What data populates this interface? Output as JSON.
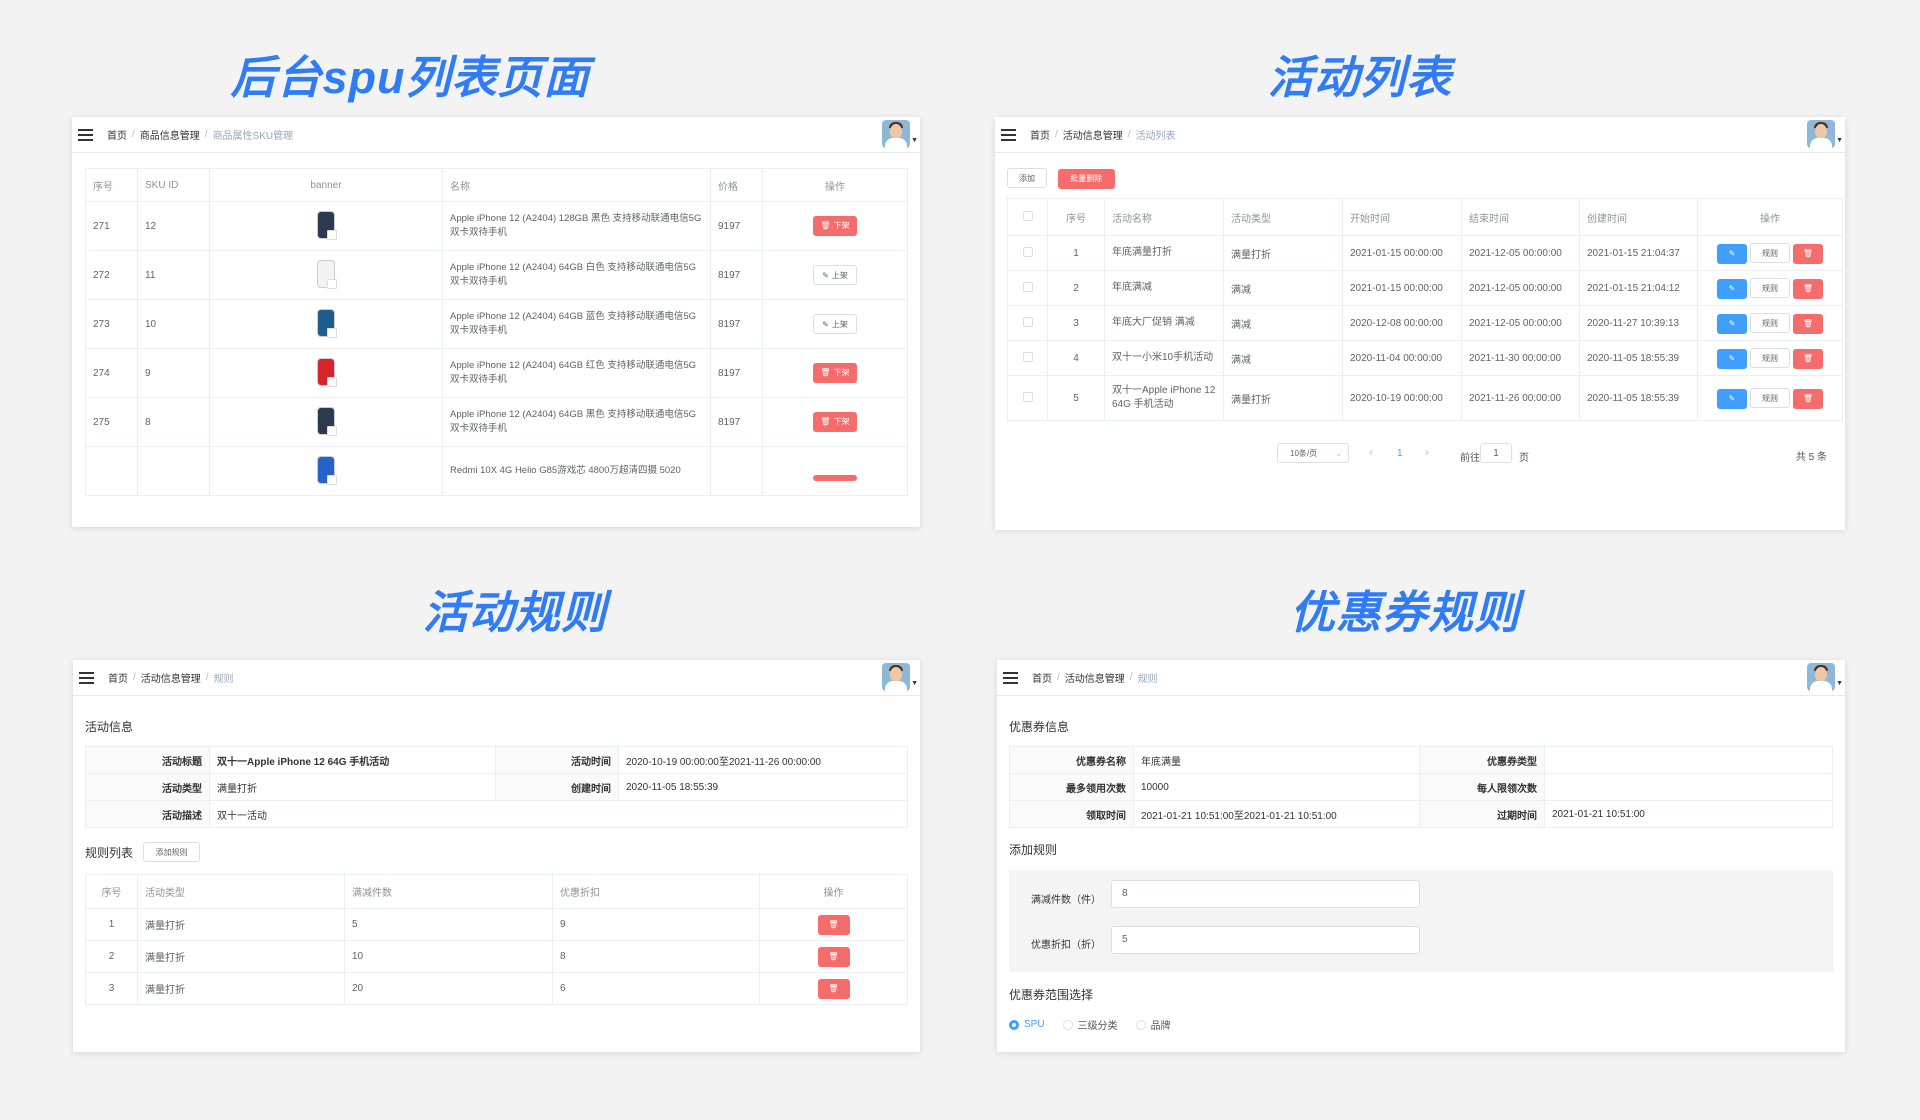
{
  "titles": {
    "spu": "后台spu列表页面",
    "activity_list": "活动列表",
    "activity_rule": "活动规则",
    "coupon_rule": "优惠券规则"
  },
  "colors": {
    "title": "#2f7cf6",
    "danger": "#f56c6c",
    "primary": "#409eff"
  },
  "panel1": {
    "breadcrumb": [
      "首页",
      "商品信息管理",
      "商品属性SKU管理"
    ],
    "headers": [
      "序号",
      "SKU ID",
      "banner",
      "名称",
      "价格",
      "操作"
    ],
    "rows": [
      {
        "no": "271",
        "sku": "12",
        "phone_color": "#2b3a4f",
        "name": "Apple iPhone 12 (A2404) 128GB 黑色 支持移动联通电信5G 双卡双待手机",
        "price": "9197",
        "action": "下架",
        "action_icon": "trash-icon",
        "action_type": "danger"
      },
      {
        "no": "272",
        "sku": "11",
        "phone_color": "#f3f3f3",
        "name": "Apple iPhone 12 (A2404) 64GB 白色 支持移动联通电信5G 双卡双待手机",
        "price": "8197",
        "action": "上架",
        "action_icon": "edit-icon",
        "action_type": "plain"
      },
      {
        "no": "273",
        "sku": "10",
        "phone_color": "#1f5d8c",
        "name": "Apple iPhone 12 (A2404) 64GB 蓝色 支持移动联通电信5G 双卡双待手机",
        "price": "8197",
        "action": "上架",
        "action_icon": "edit-icon",
        "action_type": "plain"
      },
      {
        "no": "274",
        "sku": "9",
        "phone_color": "#d8232a",
        "name": "Apple iPhone 12 (A2404) 64GB 红色 支持移动联通电信5G 双卡双待手机",
        "price": "8197",
        "action": "下架",
        "action_icon": "trash-icon",
        "action_type": "danger"
      },
      {
        "no": "275",
        "sku": "8",
        "phone_color": "#2b3a4f",
        "name": "Apple iPhone 12 (A2404) 64GB 黑色 支持移动联通电信5G 双卡双待手机",
        "price": "8197",
        "action": "下架",
        "action_icon": "trash-icon",
        "action_type": "danger"
      },
      {
        "no": "",
        "sku": "",
        "phone_color": "#2563c9",
        "name": "Redmi 10X 4G Helio G85游戏芯 4800万超清四摄 5020",
        "price": "",
        "action": "",
        "action_icon": "",
        "action_type": "danger"
      }
    ]
  },
  "panel2": {
    "breadcrumb": [
      "首页",
      "活动信息管理",
      "活动列表"
    ],
    "add_label": "添加",
    "batch_delete_label": "批量删除",
    "headers": [
      "序号",
      "活动名称",
      "活动类型",
      "开始时间",
      "结束时间",
      "创建时间",
      "操作"
    ],
    "rows": [
      {
        "no": "1",
        "name": "年底满量打折",
        "type": "满量打折",
        "start": "2021-01-15 00:00:00",
        "end": "2021-12-05 00:00:00",
        "created": "2021-01-15 21:04:37"
      },
      {
        "no": "2",
        "name": "年底满减",
        "type": "满减",
        "start": "2021-01-15 00:00:00",
        "end": "2021-12-05 00:00:00",
        "created": "2021-01-15 21:04:12"
      },
      {
        "no": "3",
        "name": "年底大厂促销 满减",
        "type": "满减",
        "start": "2020-12-08 00:00:00",
        "end": "2021-12-05 00:00:00",
        "created": "2020-11-27 10:39:13"
      },
      {
        "no": "4",
        "name": "双十一小米10手机活动",
        "type": "满减",
        "start": "2020-11-04 00:00:00",
        "end": "2021-11-30 00:00:00",
        "created": "2020-11-05 18:55:39"
      },
      {
        "no": "5",
        "name": "双十一Apple iPhone 12 64G 手机活动",
        "type": "满量打折",
        "start": "2020-10-19 00:00:00",
        "end": "2021-11-26 00:00:00",
        "created": "2020-11-05 18:55:39"
      }
    ],
    "rule_label": "规则",
    "pagination": {
      "page_size": "10条/页",
      "current_page": "1",
      "goto_label": "前往",
      "goto_value": "1",
      "page_unit": "页",
      "total": "共 5 条"
    }
  },
  "panel3": {
    "breadcrumb": [
      "首页",
      "活动信息管理",
      "规则"
    ],
    "info_heading": "活动信息",
    "info": {
      "title_label": "活动标题",
      "title_value": "双十一Apple iPhone 12 64G 手机活动",
      "time_label": "活动时间",
      "time_value": "2020-10-19 00:00:00至2021-11-26 00:00:00",
      "type_label": "活动类型",
      "type_value": "满量打折",
      "created_label": "创建时间",
      "created_value": "2020-11-05 18:55:39",
      "desc_label": "活动描述",
      "desc_value": "双十一活动"
    },
    "rules_heading": "规则列表",
    "add_rule_label": "添加规则",
    "headers": [
      "序号",
      "活动类型",
      "满减件数",
      "优惠折扣",
      "操作"
    ],
    "rows": [
      {
        "no": "1",
        "type": "满量打折",
        "count": "5",
        "discount": "9"
      },
      {
        "no": "2",
        "type": "满量打折",
        "count": "10",
        "discount": "8"
      },
      {
        "no": "3",
        "type": "满量打折",
        "count": "20",
        "discount": "6"
      }
    ]
  },
  "panel4": {
    "breadcrumb": [
      "首页",
      "活动信息管理",
      "规则"
    ],
    "info_heading": "优惠券信息",
    "info": {
      "name_label": "优惠券名称",
      "name_value": "年底满量",
      "type_label": "优惠券类型",
      "type_value": "",
      "max_label": "最多领用次数",
      "max_value": "10000",
      "limit_label": "每人限领次数",
      "limit_value": "",
      "get_time_label": "领取时间",
      "get_time_value": "2021-01-21 10:51:00至2021-01-21 10:51:00",
      "expire_label": "过期时间",
      "expire_value": "2021-01-21 10:51:00"
    },
    "add_rule_heading": "添加规则",
    "form": {
      "count_label": "满减件数（件）",
      "count_value": "8",
      "discount_label": "优惠折扣（折）",
      "discount_value": "5"
    },
    "range_heading": "优惠券范围选择",
    "range_options": [
      "SPU",
      "三级分类",
      "品牌"
    ]
  }
}
